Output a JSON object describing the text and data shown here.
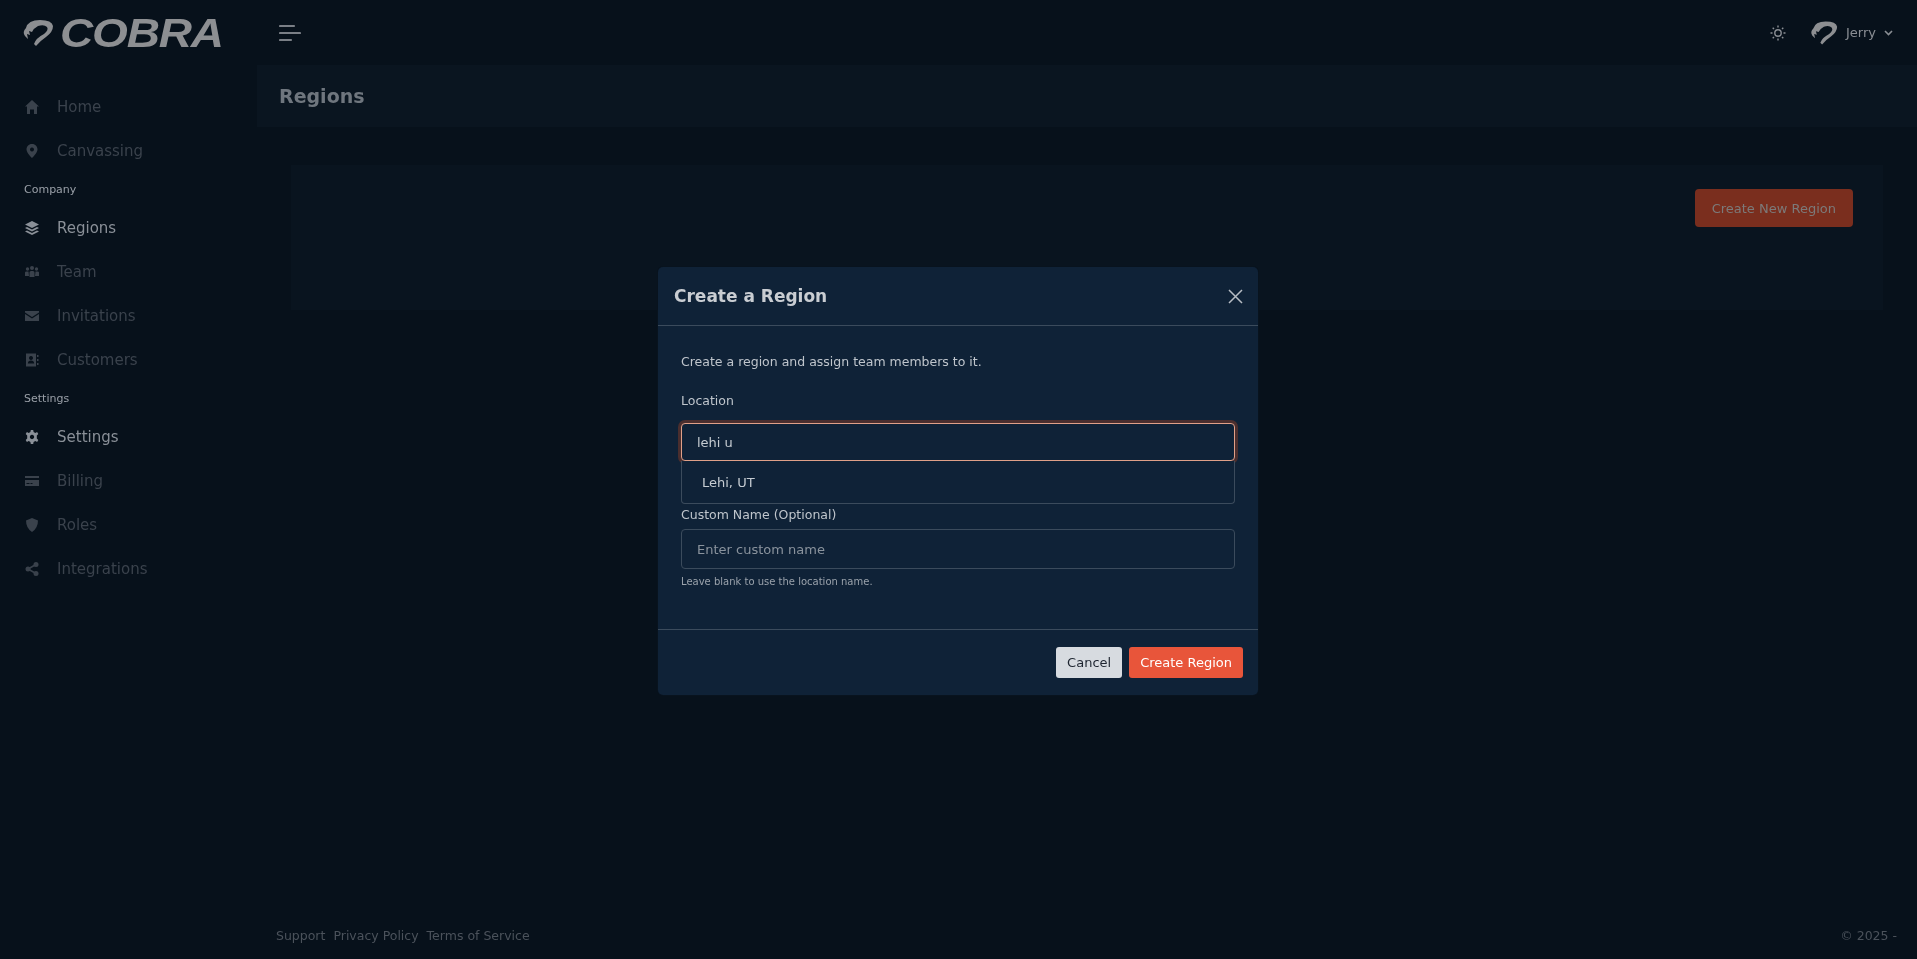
{
  "brand": "COBRA",
  "topbar": {
    "user": "Jerry"
  },
  "sidebar": {
    "groups": [
      {
        "items": [
          {
            "label": "Home",
            "selected": false
          },
          {
            "label": "Canvassing",
            "selected": false
          }
        ]
      },
      {
        "heading": "Company",
        "items": [
          {
            "label": "Regions",
            "selected": true
          },
          {
            "label": "Team",
            "selected": false
          },
          {
            "label": "Invitations",
            "selected": false
          },
          {
            "label": "Customers",
            "selected": false
          }
        ]
      },
      {
        "heading": "Settings",
        "items": [
          {
            "label": "Settings",
            "selected": true
          },
          {
            "label": "Billing",
            "selected": false
          },
          {
            "label": "Roles",
            "selected": false
          },
          {
            "label": "Integrations",
            "selected": false
          }
        ]
      }
    ]
  },
  "page": {
    "title": "Regions",
    "action": "Create New Region"
  },
  "modal": {
    "title": "Create a Region",
    "intro": "Create a region and assign team members to it.",
    "location": {
      "label": "Location",
      "value": "lehi u",
      "suggestions": [
        "Lehi, UT"
      ]
    },
    "custom_name": {
      "label": "Custom Name (Optional)",
      "placeholder": "Enter custom name",
      "help": "Leave blank to use the location name."
    },
    "buttons": [
      {
        "label": "Cancel",
        "kind": "secondary"
      },
      {
        "label": "Create Region",
        "kind": "primary"
      }
    ]
  },
  "footer": {
    "links": [
      "Support",
      "Privacy Policy",
      "Terms of Service"
    ],
    "copyright": "© 2025 -"
  }
}
